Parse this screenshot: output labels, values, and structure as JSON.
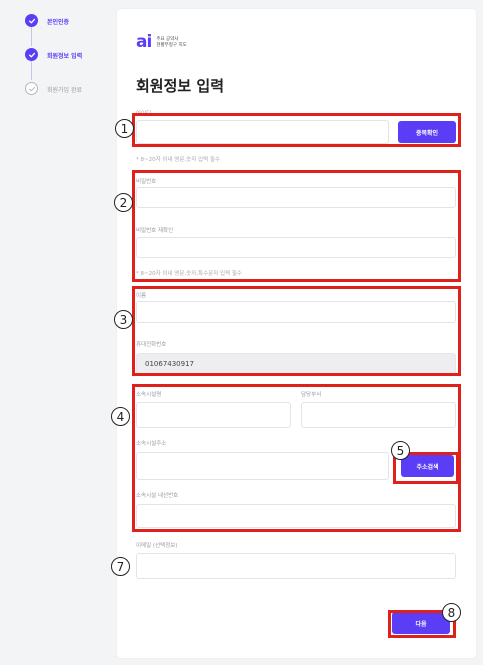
{
  "stepper": {
    "steps": [
      {
        "label": "본인인증",
        "state": "done"
      },
      {
        "label": "회원정보 입력",
        "state": "done"
      },
      {
        "label": "회원가입 완료",
        "state": "todo"
      }
    ]
  },
  "logo": {
    "mark": "ai",
    "line1": "주요 공약사",
    "line2": "현황부정구 지도"
  },
  "form": {
    "title": "회원정보 입력",
    "id_label": "아이디",
    "dup_check_button": "중복확인",
    "id_hint": "* 8~20자 이내 영문,숫자 입력 필수",
    "password_label": "비밀번호",
    "password_confirm_label": "비밀번호 재확인",
    "password_hint": "* 8~20자 이내 영문,숫자,특수문자 입력 필수",
    "name_label": "이름",
    "phone_label": "휴대전화번호",
    "phone_value": "01067430917",
    "facility_name_label": "소속시설명",
    "department_label": "담당부서",
    "facility_address_label": "소속시설주소",
    "address_search_button": "주소검색",
    "extension_label": "소속시설 내선번호",
    "email_label": "이메일 (선택정보)",
    "next_button": "다음"
  },
  "annotations": {
    "badges": [
      "1",
      "2",
      "3",
      "4",
      "5",
      "7",
      "8"
    ],
    "color": "#e0201b"
  },
  "colors": {
    "accent": "#5b3df5",
    "annotation": "#e0201b"
  }
}
